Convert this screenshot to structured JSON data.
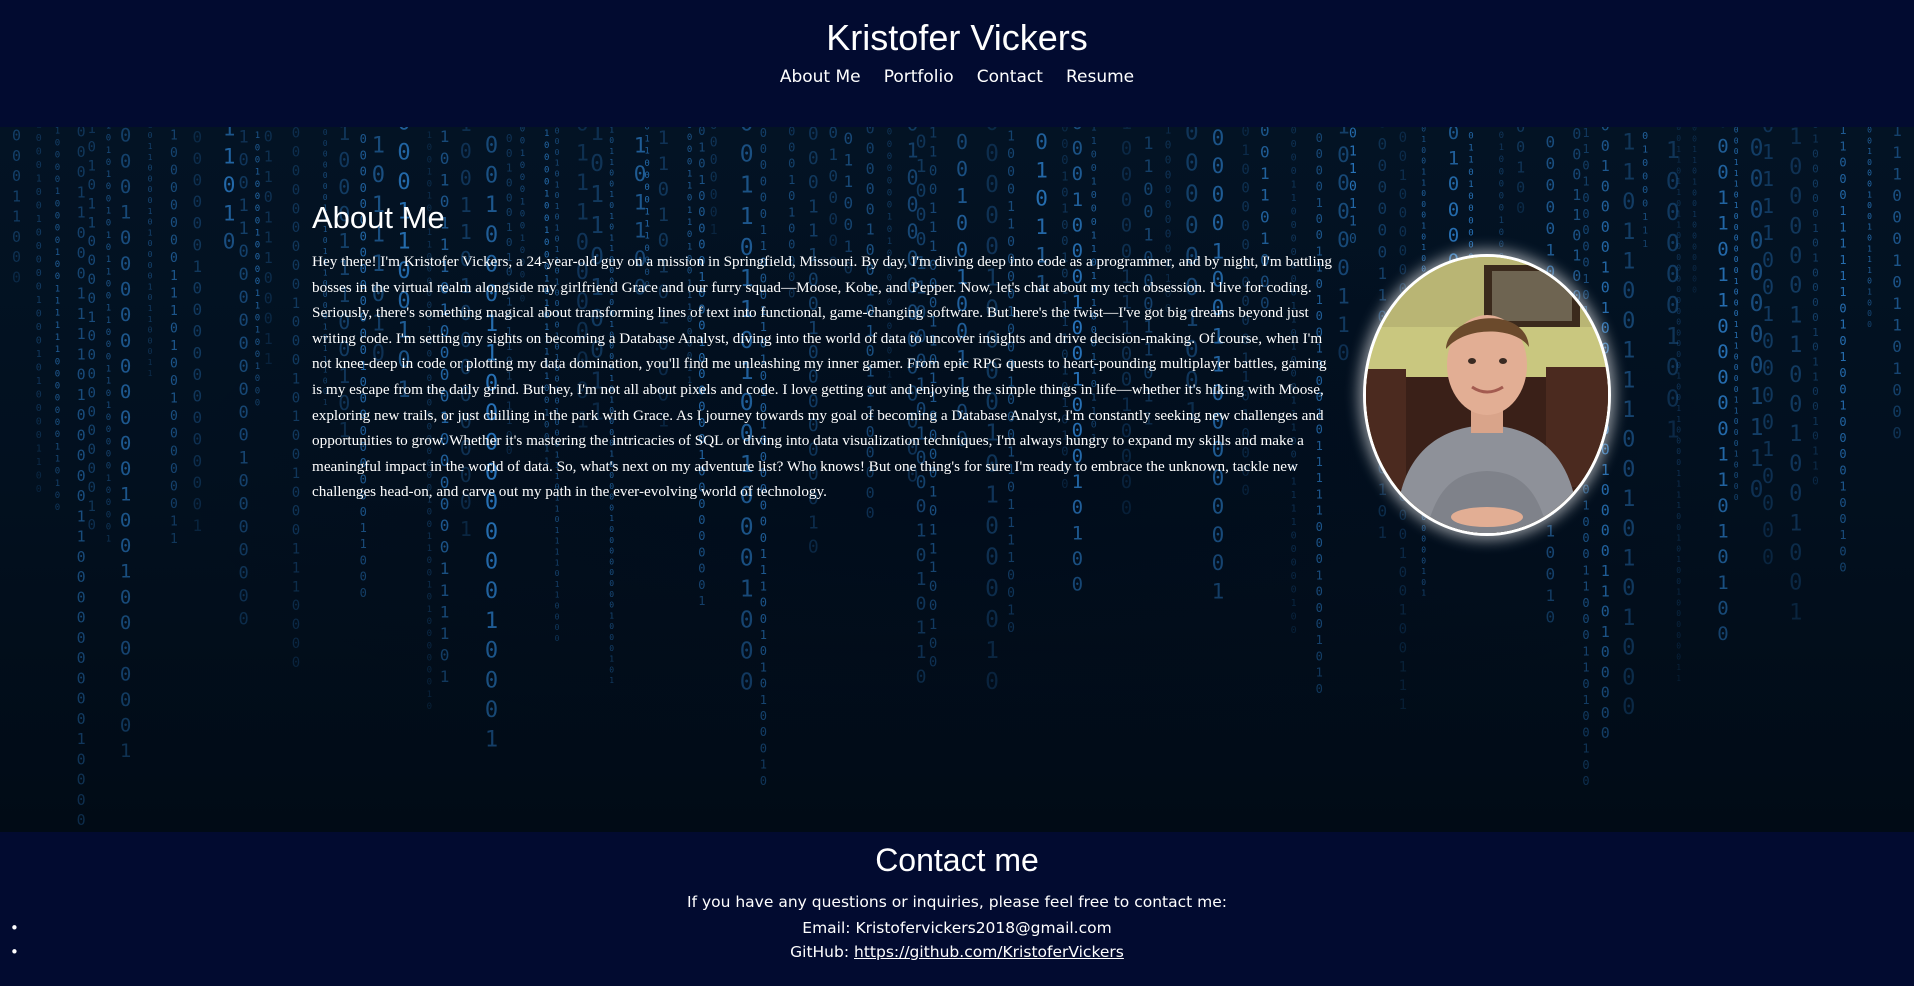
{
  "header": {
    "title": "Kristofer Vickers",
    "nav": [
      {
        "label": "About Me"
      },
      {
        "label": "Portfolio"
      },
      {
        "label": "Contact"
      },
      {
        "label": "Resume"
      }
    ]
  },
  "about": {
    "heading": "About Me",
    "body": "Hey there! I'm Kristofer Vickers, a 24-year-old guy on a mission in Springfield, Missouri. By day, I'm diving deep into code as a programmer, and by night, I'm battling bosses in the virtual realm alongside my girlfriend Grace and our furry squad—Moose, Kobe, and Pepper. Now, let's chat about my tech obsession. I live for coding. Seriously, there's something magical about transforming lines of text into functional, game-changing software. But here's the twist—I've got big dreams beyond just writing code. I'm setting my sights on becoming a Database Analyst, diving into the world of data to uncover insights and drive decision-making. Of course, when I'm not knee-deep in code or plotting my data domination, you'll find me unleashing my inner gamer. From epic RPG quests to heart-pounding multiplayer battles, gaming is my escape from the daily grind. But hey, I'm not all about pixels and code. I love getting out and enjoying the simple things in life—whether it's hiking with Moose, exploring new trails, or just chilling in the park with Grace. As I journey towards my goal of becoming a Database Analyst, I'm constantly seeking new challenges and opportunities to grow. Whether it's mastering the intricacies of SQL or diving into data visualization techniques, I'm always hungry to expand my skills and make a meaningful impact in the world of data. So, what's next on my adventure list? Who knows! But one thing's for sure I'm ready to embrace the unknown, tackle new challenges head-on, and carve out my path in the ever-evolving world of technology."
  },
  "contact": {
    "heading": "Contact me",
    "intro": "If you have any questions or inquiries, please feel free to contact me:",
    "email_prefix": "Email: ",
    "email": "Kristofervickers2018@gmail.com",
    "github_prefix": "GitHub: ",
    "github_url": "https://github.com/KristoferVickers",
    "bullet": "•"
  },
  "colors": {
    "header_bg": "#020b30",
    "footer_bg": "#020b30",
    "text": "#ffffff",
    "rain": "#2f86d6"
  }
}
